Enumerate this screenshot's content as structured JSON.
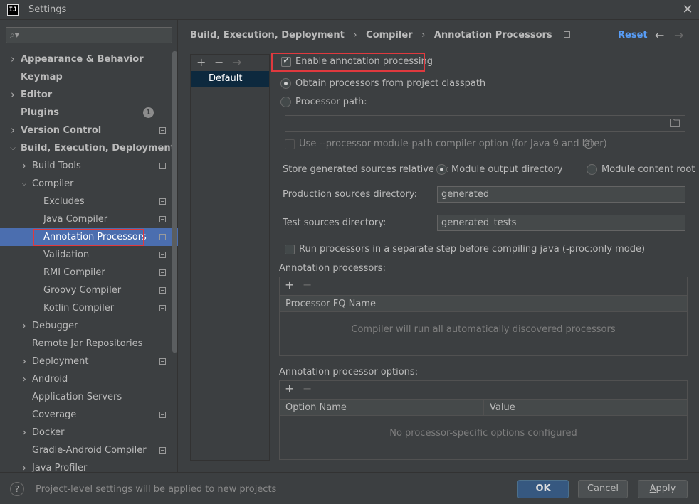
{
  "window": {
    "title": "Settings",
    "logo_text": "IJ",
    "close_glyph": "✕"
  },
  "search": {
    "placeholder": "",
    "icon": "search-icon"
  },
  "sidebar": {
    "items": [
      {
        "label": "Appearance & Behavior",
        "chevron": "›",
        "bold": true
      },
      {
        "label": "Keymap",
        "bold": true
      },
      {
        "label": "Editor",
        "chevron": "›",
        "bold": true
      },
      {
        "label": "Plugins",
        "bold": true,
        "badge": "1"
      },
      {
        "label": "Version Control",
        "chevron": "›",
        "bold": true
      },
      {
        "label": "Build, Execution, Deployment",
        "chevron": "⌄",
        "bold": true
      },
      {
        "label": "Build Tools",
        "chevron": "›"
      },
      {
        "label": "Compiler",
        "chevron": "⌄"
      },
      {
        "label": "Excludes"
      },
      {
        "label": "Java Compiler"
      },
      {
        "label": "Annotation Processors",
        "selected": true
      },
      {
        "label": "Validation"
      },
      {
        "label": "RMI Compiler"
      },
      {
        "label": "Groovy Compiler"
      },
      {
        "label": "Kotlin Compiler"
      },
      {
        "label": "Debugger",
        "chevron": "›"
      },
      {
        "label": "Remote Jar Repositories"
      },
      {
        "label": "Deployment",
        "chevron": "›"
      },
      {
        "label": "Android",
        "chevron": "›"
      },
      {
        "label": "Application Servers"
      },
      {
        "label": "Coverage"
      },
      {
        "label": "Docker",
        "chevron": "›"
      },
      {
        "label": "Gradle-Android Compiler"
      },
      {
        "label": "Java Profiler",
        "chevron": "›"
      }
    ]
  },
  "header": {
    "breadcrumb": [
      "Build, Execution, Deployment",
      "Compiler",
      "Annotation Processors"
    ],
    "separator": "›",
    "reset_label": "Reset",
    "back_glyph": "←",
    "forward_glyph": "→"
  },
  "profiles": {
    "add_glyph": "+",
    "remove_glyph": "−",
    "move_glyph": "→",
    "items": [
      "Default"
    ]
  },
  "main": {
    "enable_label": "Enable annotation processing",
    "enable_checked": true,
    "obtain_label": "Obtain processors from project classpath",
    "processor_path_label": "Processor path:",
    "processor_path_value": "",
    "module_path_option_label": "Use --processor-module-path compiler option (for Java 9 and later)",
    "help_glyph": "?",
    "store_label": "Store generated sources relative to:",
    "module_output_label": "Module output directory",
    "module_content_label": "Module content root",
    "production_label": "Production sources directory:",
    "production_value": "generated",
    "test_label": "Test sources directory:",
    "test_value": "generated_tests",
    "separate_step_label": "Run processors in a separate step before compiling java (-proc:only mode)",
    "processors_section_label": "Annotation processors:",
    "processors_add": "+",
    "processors_remove": "−",
    "processors_column": "Processor FQ Name",
    "processors_empty": "Compiler will run all automatically discovered processors",
    "options_section_label": "Annotation processor options:",
    "options_add": "+",
    "options_remove": "−",
    "options_columns": [
      "Option Name",
      "Value"
    ],
    "options_empty": "No processor-specific options configured"
  },
  "footer": {
    "help_glyph": "?",
    "note": "Project-level settings will be applied to new projects",
    "ok_label": "OK",
    "cancel_label": "Cancel",
    "apply_prefix": "A",
    "apply_rest": "pply"
  },
  "colors": {
    "accent": "#589df6",
    "selection": "#4b6eaf",
    "highlight_box": "#e0393e",
    "background": "#3c3f41"
  }
}
